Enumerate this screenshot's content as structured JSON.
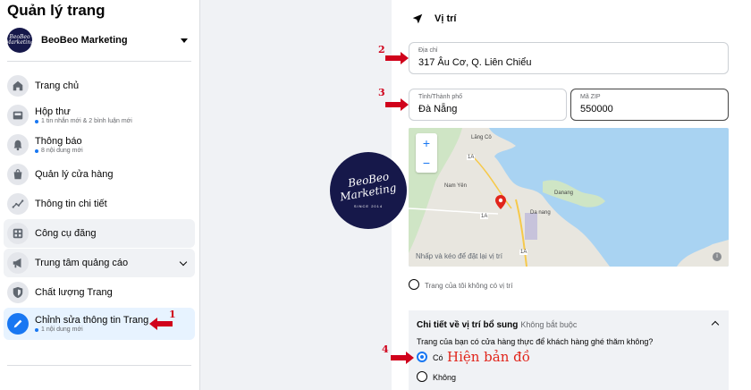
{
  "sidebar": {
    "title": "Quản lý trang",
    "page_name": "BeoBeo Marketing",
    "avatar_text": "BeoBeo Marketing",
    "items": [
      {
        "label": "Trang chủ",
        "sub": ""
      },
      {
        "label": "Hộp thư",
        "sub": "1 tin nhắn mới & 2 bình luận mới"
      },
      {
        "label": "Thông báo",
        "sub": "8 nội dung mới"
      },
      {
        "label": "Quản lý cửa hàng",
        "sub": ""
      },
      {
        "label": "Thông tin chi tiết",
        "sub": ""
      },
      {
        "label": "Công cụ đăng",
        "sub": ""
      },
      {
        "label": "Trung tâm quảng cáo",
        "sub": ""
      },
      {
        "label": "Chất lượng Trang",
        "sub": ""
      },
      {
        "label": "Chỉnh sửa thông tin Trang",
        "sub": "1 nội dung mới"
      }
    ]
  },
  "location": {
    "title": "Vị trí",
    "address": {
      "label": "Địa chỉ",
      "value": "317 Âu Cơ, Q. Liên Chiểu"
    },
    "city": {
      "label": "Tỉnh/Thành phố",
      "value": "Đà Nẵng"
    },
    "zip": {
      "label": "Mã ZIP",
      "value": "550000"
    },
    "map": {
      "zoom_in": "+",
      "zoom_out": "−",
      "hint": "Nhấp và kéo để đặt lại vị trí",
      "info": "i",
      "labels": [
        "Lăng Cô",
        "Nam Yên",
        "Danang",
        "Da nang",
        "1A",
        "1A",
        "1A"
      ]
    },
    "no_location": "Trang của tôi không có vị trí"
  },
  "extra": {
    "title": "Chi tiết về vị trí bổ sung",
    "optional": "Không bắt buộc",
    "question": "Trang của bạn có cửa hàng thực để khách hàng ghé thăm không?",
    "yes": "Có",
    "no": "Không"
  },
  "logo": {
    "line1": "BeoBeo",
    "line2": "Marketing",
    "line3": "SINCE 2014"
  },
  "annotations": {
    "n1": "1",
    "n2": "2",
    "n3": "3",
    "n4": "4",
    "note": "Hiện bản đồ"
  },
  "colors": {
    "accent": "#1877f2",
    "annotation": "#d0021b",
    "logo_bg": "#16184a"
  }
}
